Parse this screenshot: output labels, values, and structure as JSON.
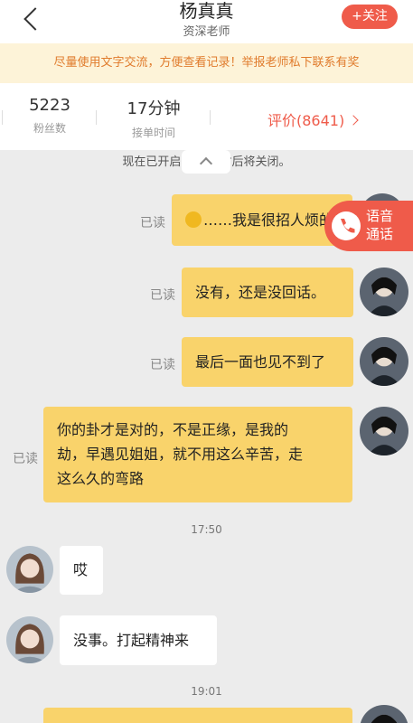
{
  "header": {
    "title": "杨真真",
    "subtitle": "资深老师",
    "follow": "+关注"
  },
  "notice": "尽量使用文字交流，方便查看记录！举报老师私下联系有奖",
  "stats": {
    "fans": {
      "value": "5223",
      "label": "粉丝数"
    },
    "time": {
      "value": "17分钟",
      "label": "接单时间"
    },
    "rating": "评价(8641)"
  },
  "system_message": "现在已开启临时        小时后将关闭。",
  "voice_call": {
    "line1": "语音",
    "line2": "通话"
  },
  "messages": {
    "m1": {
      "read": "已读",
      "text": "……我是很招人烦的"
    },
    "m2": {
      "read": "已读",
      "text": "没有，还是没回话。"
    },
    "m3": {
      "read": "已读",
      "text": "最后一面也见不到了"
    },
    "m4": {
      "read": "已读",
      "line1": "你的卦才是对的，不是正缘，是我的",
      "line2": "劫，早遇见姐姐，就不用这么辛苦，走",
      "line3": "这么久的弯路"
    },
    "t1": "17:50",
    "m5": {
      "text": "哎"
    },
    "m6": {
      "text": "没事。打起精神来"
    },
    "t2": "19:01"
  },
  "colors": {
    "accent": "#ef5b4a",
    "bubble_self": "#f9d36b",
    "notice_text": "#e07b2c"
  }
}
